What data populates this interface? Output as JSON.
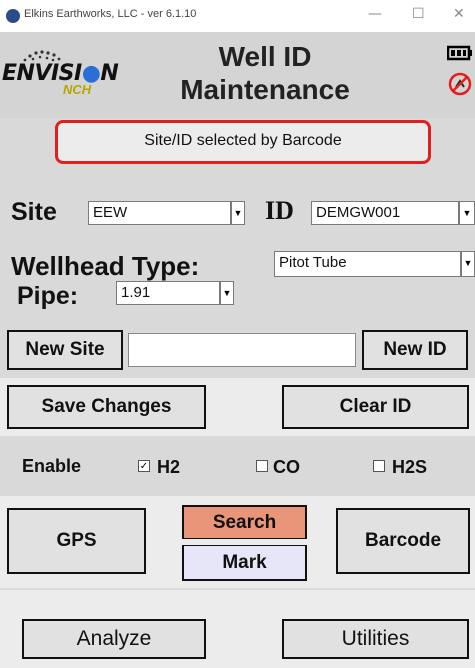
{
  "window": {
    "title": "Elkins Earthworks, LLC - ver 6.1.10",
    "minimize": "—",
    "maximize": "☐",
    "close": "✕"
  },
  "header": {
    "logo_text": "ENVISI",
    "logo_text2": "N",
    "logo_sub": "NCH",
    "title_line1": "Well ID",
    "title_line2": "Maintenance"
  },
  "status_message": "Site/ID selected by Barcode",
  "site": {
    "label": "Site",
    "value": "EEW"
  },
  "id": {
    "label": "ID",
    "value": "DEMGW001"
  },
  "wellhead": {
    "label": "Wellhead Type:",
    "value": "Pitot Tube"
  },
  "pipe": {
    "label": "Pipe:",
    "value": "1.91"
  },
  "buttons": {
    "new_site": "New Site",
    "new_id": "New ID",
    "save_changes": "Save Changes",
    "clear_id": "Clear ID",
    "gps": "GPS",
    "search": "Search",
    "mark": "Mark",
    "barcode": "Barcode",
    "analyze": "Analyze",
    "utilities": "Utilities"
  },
  "new_site_input": {
    "value": ""
  },
  "enable": {
    "label": "Enable",
    "options": [
      {
        "label": "H2",
        "checked": true
      },
      {
        "label": "CO",
        "checked": false
      },
      {
        "label": "H2S",
        "checked": false
      }
    ]
  },
  "colors": {
    "search_bg": "#e8957a",
    "mark_bg": "#e6e6f8",
    "status_border": "#e01f1f"
  }
}
